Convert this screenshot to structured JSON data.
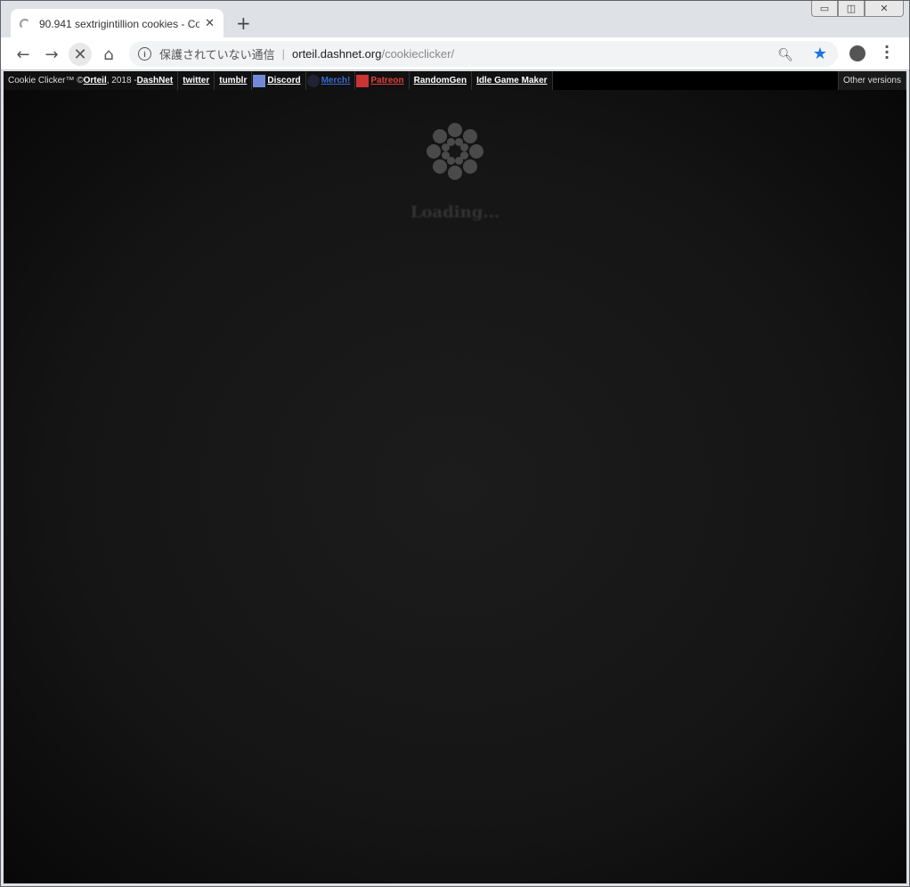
{
  "browser": {
    "tab_title": "90.941 sextrigintillion cookies - Co",
    "security_label": "保護されていない通信",
    "url_host": "orteil.dashnet.org",
    "url_path": "/cookieclicker/",
    "accent": "#1a73e8"
  },
  "topbar": {
    "copyright_prefix": "Cookie Clicker™ © ",
    "author": "Orteil",
    "year_text": ", 2018 - ",
    "dashnet": "DashNet",
    "links": [
      "twitter",
      "tumblr",
      "Discord",
      "Merch!",
      "Patreon",
      "RandomGen",
      "Idle Game Maker"
    ],
    "other_versions": "Other versions"
  },
  "game": {
    "loading_text": "Loading..."
  }
}
